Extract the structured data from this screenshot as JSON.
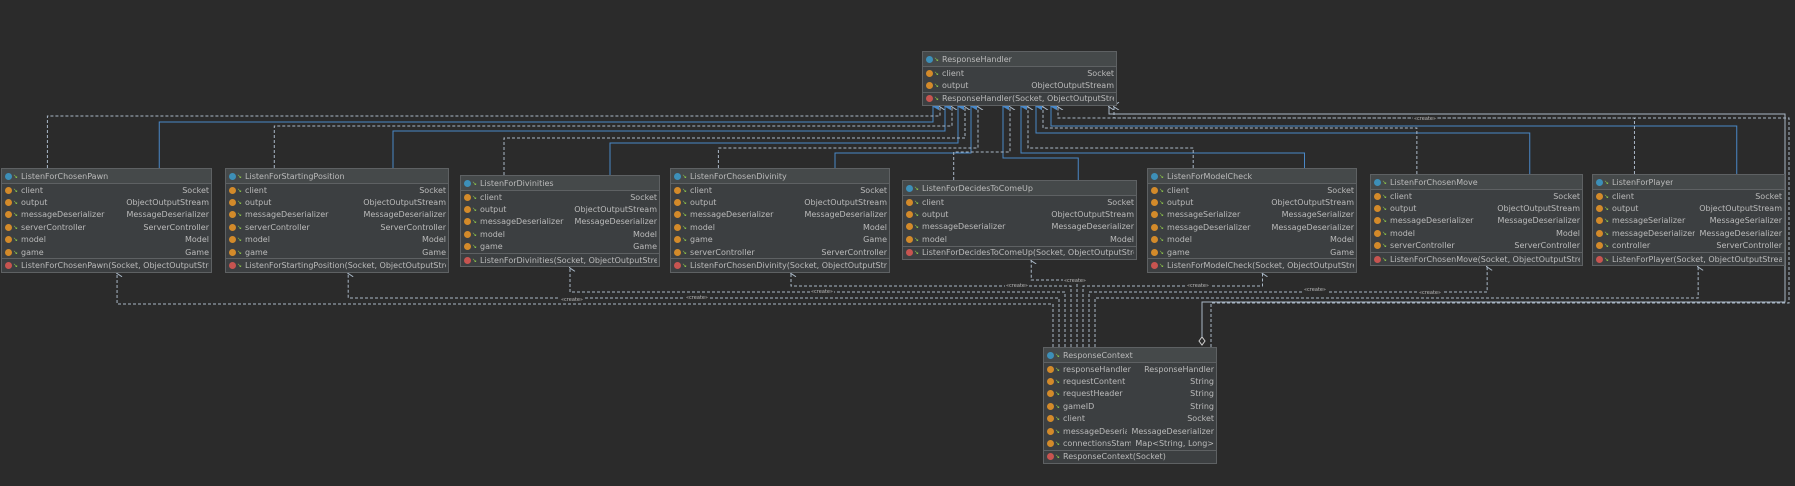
{
  "classes": [
    {
      "id": "ResponseHandler",
      "name": "ResponseHandler",
      "fields": [
        {
          "name": "client",
          "type": "Socket"
        },
        {
          "name": "output",
          "type": "ObjectOutputStream"
        }
      ],
      "methods": [
        "ResponseHandler(Socket, ObjectOutputStream)"
      ]
    },
    {
      "id": "ListenForChosenPawn",
      "name": "ListenForChosenPawn",
      "fields": [
        {
          "name": "client",
          "type": "Socket"
        },
        {
          "name": "output",
          "type": "ObjectOutputStream"
        },
        {
          "name": "messageDeserializer",
          "type": "MessageDeserializer"
        },
        {
          "name": "serverController",
          "type": "ServerController"
        },
        {
          "name": "model",
          "type": "Model"
        },
        {
          "name": "game",
          "type": "Game"
        }
      ],
      "methods": [
        "ListenForChosenPawn(Socket, ObjectOutputStream)"
      ]
    },
    {
      "id": "ListenForStartingPosition",
      "name": "ListenForStartingPosition",
      "fields": [
        {
          "name": "client",
          "type": "Socket"
        },
        {
          "name": "output",
          "type": "ObjectOutputStream"
        },
        {
          "name": "messageDeserializer",
          "type": "MessageDeserializer"
        },
        {
          "name": "serverController",
          "type": "ServerController"
        },
        {
          "name": "model",
          "type": "Model"
        },
        {
          "name": "game",
          "type": "Game"
        }
      ],
      "methods": [
        "ListenForStartingPosition(Socket, ObjectOutputStream)"
      ]
    },
    {
      "id": "ListenForDivinities",
      "name": "ListenForDivinities",
      "fields": [
        {
          "name": "client",
          "type": "Socket"
        },
        {
          "name": "output",
          "type": "ObjectOutputStream"
        },
        {
          "name": "messageDeserializer",
          "type": "MessageDeserializer"
        },
        {
          "name": "model",
          "type": "Model"
        },
        {
          "name": "game",
          "type": "Game"
        }
      ],
      "methods": [
        "ListenForDivinities(Socket, ObjectOutputStream)"
      ]
    },
    {
      "id": "ListenForChosenDivinity",
      "name": "ListenForChosenDivinity",
      "fields": [
        {
          "name": "client",
          "type": "Socket"
        },
        {
          "name": "output",
          "type": "ObjectOutputStream"
        },
        {
          "name": "messageDeserializer",
          "type": "MessageDeserializer"
        },
        {
          "name": "model",
          "type": "Model"
        },
        {
          "name": "game",
          "type": "Game"
        },
        {
          "name": "serverController",
          "type": "ServerController"
        }
      ],
      "methods": [
        "ListenForChosenDivinity(Socket, ObjectOutputStream)"
      ]
    },
    {
      "id": "ListenForDecidesToComeUp",
      "name": "ListenForDecidesToComeUp",
      "fields": [
        {
          "name": "client",
          "type": "Socket"
        },
        {
          "name": "output",
          "type": "ObjectOutputStream"
        },
        {
          "name": "messageDeserializer",
          "type": "MessageDeserializer"
        },
        {
          "name": "model",
          "type": "Model"
        }
      ],
      "methods": [
        "ListenForDecidesToComeUp(Socket, ObjectOutputStream)"
      ]
    },
    {
      "id": "ListenForModelCheck",
      "name": "ListenForModelCheck",
      "fields": [
        {
          "name": "client",
          "type": "Socket"
        },
        {
          "name": "output",
          "type": "ObjectOutputStream"
        },
        {
          "name": "messageSerializer",
          "type": "MessageSerializer"
        },
        {
          "name": "messageDeserializer",
          "type": "MessageDeserializer"
        },
        {
          "name": "model",
          "type": "Model"
        },
        {
          "name": "game",
          "type": "Game"
        }
      ],
      "methods": [
        "ListenForModelCheck(Socket, ObjectOutputStream)"
      ]
    },
    {
      "id": "ListenForChosenMove",
      "name": "ListenForChosenMove",
      "fields": [
        {
          "name": "client",
          "type": "Socket"
        },
        {
          "name": "output",
          "type": "ObjectOutputStream"
        },
        {
          "name": "messageDeserializer",
          "type": "MessageDeserializer"
        },
        {
          "name": "model",
          "type": "Model"
        },
        {
          "name": "serverController",
          "type": "ServerController"
        }
      ],
      "methods": [
        "ListenForChosenMove(Socket, ObjectOutputStream)"
      ]
    },
    {
      "id": "ListenForPlayer",
      "name": "ListenForPlayer",
      "fields": [
        {
          "name": "client",
          "type": "Socket"
        },
        {
          "name": "output",
          "type": "ObjectOutputStream"
        },
        {
          "name": "messageSerializer",
          "type": "MessageSerializer"
        },
        {
          "name": "messageDeserializer",
          "type": "MessageDeserializer"
        },
        {
          "name": "controller",
          "type": "ServerController"
        }
      ],
      "methods": [
        "ListenForPlayer(Socket, ObjectOutputStream)"
      ]
    },
    {
      "id": "ResponseContext",
      "name": "ResponseContext",
      "fields": [
        {
          "name": "responseHandler",
          "type": "ResponseHandler"
        },
        {
          "name": "requestContent",
          "type": "String"
        },
        {
          "name": "requestHeader",
          "type": "String"
        },
        {
          "name": "gameID",
          "type": "String"
        },
        {
          "name": "client",
          "type": "Socket"
        },
        {
          "name": "messageDeserializer",
          "type": "MessageDeserializer"
        },
        {
          "name": "connectionsStamp",
          "type": "Map<String, Long>"
        }
      ],
      "methods": [
        "ResponseContext(Socket)"
      ]
    }
  ],
  "create_label": "«create»",
  "colors": {
    "background": "#2b2b2b",
    "inheritance": "#4a88c7",
    "dependency": "#a9b7c6",
    "class_icon": "#3d8fb8",
    "field_icon": "#d38a2a",
    "method_icon": "#c75450"
  }
}
